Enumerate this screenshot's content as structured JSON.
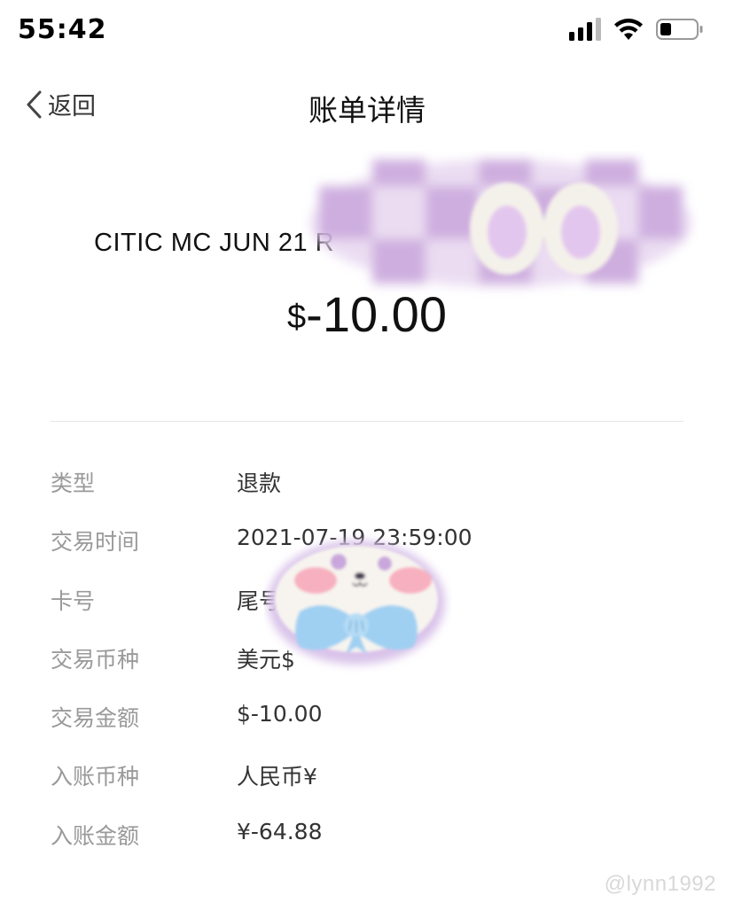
{
  "status_bar": {
    "time": "55:42",
    "icons": [
      "signal-icon",
      "wifi-icon",
      "battery-icon"
    ]
  },
  "nav": {
    "back_label": "返回",
    "title": "账单详情"
  },
  "transaction": {
    "merchant": "CITIC MC JUN 21 R",
    "currency_symbol": "$",
    "amount": "-10.00"
  },
  "details": [
    {
      "label": "类型",
      "value": "退款"
    },
    {
      "label": "交易时间",
      "value": "2021-07-19 23:59:00"
    },
    {
      "label": "卡号",
      "value": "尾号"
    },
    {
      "label": "交易币种",
      "value": "美元$"
    },
    {
      "label": "交易金额",
      "value": "$-10.00"
    },
    {
      "label": "入账币种",
      "value": "人民币¥"
    },
    {
      "label": "入账金额",
      "value": "¥-64.88"
    }
  ],
  "watermark": "@lynn1992",
  "colors": {
    "label_gray": "#9a9a9a",
    "text_dark": "#111111",
    "sticker_purple": "#c9a6dc",
    "sticker_blue": "#9fd0f2",
    "blush_pink": "#f7a3b6"
  }
}
